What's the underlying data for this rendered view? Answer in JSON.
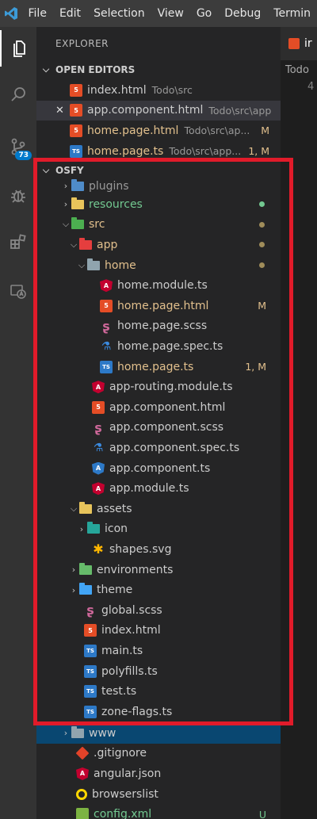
{
  "menu": [
    "File",
    "Edit",
    "Selection",
    "View",
    "Go",
    "Debug",
    "Termin"
  ],
  "activity": {
    "source_control_badge": "73"
  },
  "explorer": {
    "title": "EXPLORER",
    "open_editors": {
      "header": "OPEN EDITORS",
      "items": [
        {
          "name": "index.html",
          "desc": "Todo\\src",
          "deco": ""
        },
        {
          "name": "app.component.html",
          "desc": "Todo\\src\\app",
          "deco": "",
          "close": "✕"
        },
        {
          "name": "home.page.html",
          "desc": "Todo\\src\\ap...",
          "deco": "M"
        },
        {
          "name": "home.page.ts",
          "desc": "Todo\\src\\app...",
          "deco": "1, M"
        }
      ]
    },
    "project": {
      "header": "OSFY",
      "items": [
        {
          "name": "plugins"
        },
        {
          "name": "resources"
        },
        {
          "name": "src"
        },
        {
          "name": "app"
        },
        {
          "name": "home"
        },
        {
          "name": "home.module.ts"
        },
        {
          "name": "home.page.html",
          "deco": "M"
        },
        {
          "name": "home.page.scss"
        },
        {
          "name": "home.page.spec.ts"
        },
        {
          "name": "home.page.ts",
          "deco": "1, M"
        },
        {
          "name": "app-routing.module.ts"
        },
        {
          "name": "app.component.html"
        },
        {
          "name": "app.component.scss"
        },
        {
          "name": "app.component.spec.ts"
        },
        {
          "name": "app.component.ts"
        },
        {
          "name": "app.module.ts"
        },
        {
          "name": "assets"
        },
        {
          "name": "icon"
        },
        {
          "name": "shapes.svg"
        },
        {
          "name": "environments"
        },
        {
          "name": "theme"
        },
        {
          "name": "global.scss"
        },
        {
          "name": "index.html"
        },
        {
          "name": "main.ts"
        },
        {
          "name": "polyfills.ts"
        },
        {
          "name": "test.ts"
        },
        {
          "name": "zone-flags.ts"
        },
        {
          "name": "www"
        },
        {
          "name": ".gitignore"
        },
        {
          "name": "angular.json"
        },
        {
          "name": "browserslist"
        },
        {
          "name": "config.xml",
          "deco": "U"
        }
      ]
    }
  },
  "editor": {
    "tab_label": "ir",
    "breadcrumb": "Todo",
    "line_number": "4"
  },
  "colors": {
    "highlight": "#e11b2a",
    "modified": "#e2c08d",
    "untracked": "#73c991",
    "accent": "#007acc"
  }
}
